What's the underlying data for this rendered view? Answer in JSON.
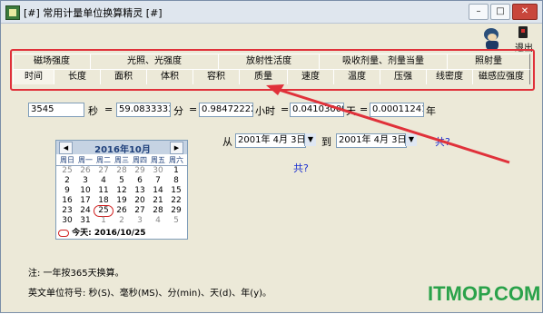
{
  "window": {
    "title": "[#] 常用计量单位换算精灵 [#]",
    "controls": {
      "minimize": "–",
      "maximize": "□",
      "close": "✕"
    }
  },
  "toolbar": {
    "exit_label": "退出",
    "exit_icon": "phone-exit-icon",
    "mascot_icon": "genie-mascot-icon"
  },
  "tabs_row1": [
    "磁场强度",
    "光照、光强度",
    "放射性活度",
    "吸收剂量、剂量当量",
    "照射量"
  ],
  "tabs_row2": [
    "时间",
    "长度",
    "面积",
    "体积",
    "容积",
    "质量",
    "速度",
    "温度",
    "压强",
    "线密度",
    "磁感应强度"
  ],
  "selected_tab": "时间",
  "converter": {
    "seconds_value": "3545",
    "seconds_unit": "秒",
    "minutes_value": "59.08333333",
    "minutes_unit": "分",
    "hours_value": "0.984722222",
    "hours_unit": "小时",
    "days_value": "0.041030093",
    "days_unit": "天",
    "years_value": "0.000112411",
    "years_unit": "年",
    "eq1": "=",
    "eq2": "=",
    "eq3": "=",
    "eq4": "="
  },
  "calendar": {
    "month_label": "2016年10月",
    "prev_label": "◀",
    "next_label": "▶",
    "weekdays": [
      "周日",
      "周一",
      "周二",
      "周三",
      "周四",
      "周五",
      "周六"
    ],
    "days": [
      [
        "25",
        "26",
        "27",
        "28",
        "29",
        "30",
        "1"
      ],
      [
        "2",
        "3",
        "4",
        "5",
        "6",
        "7",
        "8"
      ],
      [
        "9",
        "10",
        "11",
        "12",
        "13",
        "14",
        "15"
      ],
      [
        "16",
        "17",
        "18",
        "19",
        "20",
        "21",
        "22"
      ],
      [
        "23",
        "24",
        "25",
        "26",
        "27",
        "28",
        "29"
      ],
      [
        "30",
        "31",
        "1",
        "2",
        "3",
        "4",
        "5"
      ]
    ],
    "today_label": "今天: 2016/10/25"
  },
  "range": {
    "from_label": "从",
    "from_value": "2001年 4月 3日",
    "to_label": "到",
    "to_value": "2001年 4月 3日",
    "result_suffix": "共?",
    "total_label": "共?"
  },
  "notes": {
    "year_note": "注: 一年按365天换算。",
    "units_note": "英文单位符号: 秒(S)、毫秒(MS)、分(min)、天(d)、年(y)。"
  },
  "watermark": "ITMOP.COM",
  "colors": {
    "highlight": "#e0313a",
    "link_text": "#1a2fd0",
    "watermark": "#2aa24a"
  }
}
